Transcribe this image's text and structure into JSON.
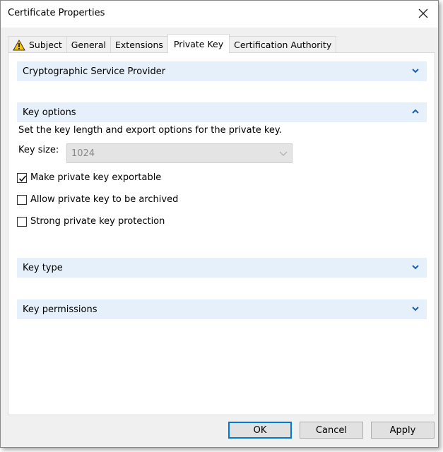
{
  "window": {
    "title": "Certificate Properties"
  },
  "tabs": [
    {
      "label": "Subject",
      "icon": "warning-icon"
    },
    {
      "label": "General"
    },
    {
      "label": "Extensions"
    },
    {
      "label": "Private Key",
      "active": true
    },
    {
      "label": "Certification Authority"
    }
  ],
  "sections": {
    "csp": {
      "label": "Cryptographic Service Provider",
      "expanded": false
    },
    "key_options": {
      "label": "Key options",
      "expanded": true,
      "description": "Set the key length and export options for the private key.",
      "key_size_label": "Key size:",
      "key_size_value": "1024",
      "checkboxes": [
        {
          "label": "Make private key exportable",
          "checked": true
        },
        {
          "label": "Allow private key to be archived",
          "checked": false
        },
        {
          "label": "Strong private key protection",
          "checked": false
        }
      ]
    },
    "key_type": {
      "label": "Key type",
      "expanded": false
    },
    "key_permissions": {
      "label": "Key permissions",
      "expanded": false
    }
  },
  "buttons": {
    "ok": "OK",
    "cancel": "Cancel",
    "apply": "Apply"
  },
  "colors": {
    "section_bg": "#e6f0fa",
    "accent": "#0078d7",
    "chevron": "#1a5fb4"
  }
}
